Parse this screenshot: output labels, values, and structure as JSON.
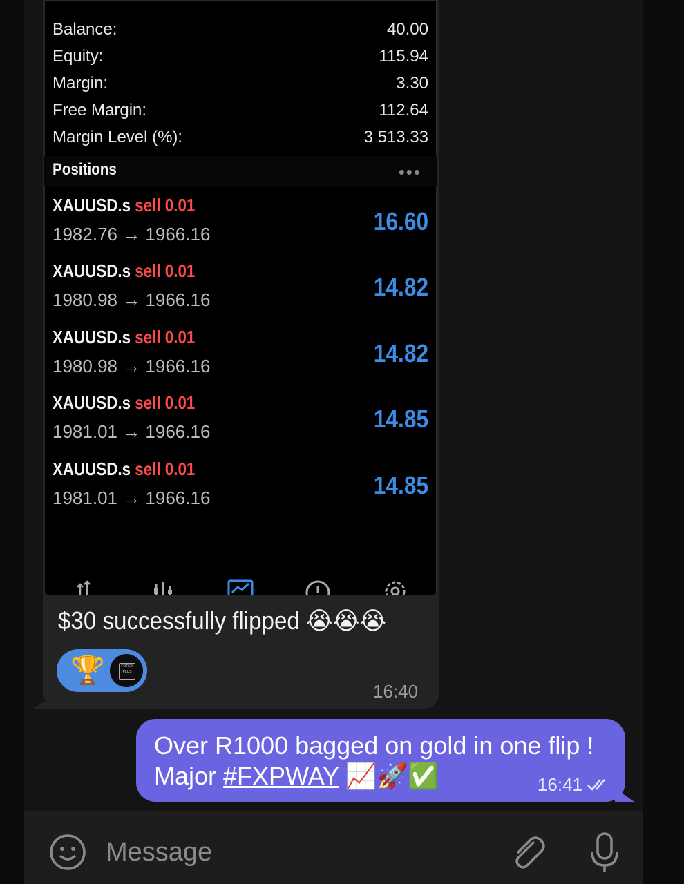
{
  "account": [
    {
      "label": "Balance:",
      "value": "40.00"
    },
    {
      "label": "Equity:",
      "value": "115.94"
    },
    {
      "label": "Margin:",
      "value": "3.30"
    },
    {
      "label": "Free Margin:",
      "value": "112.64"
    },
    {
      "label": "Margin Level (%):",
      "value": "3 513.33"
    }
  ],
  "positions_title": "Positions",
  "positions_more": "•••",
  "positions": [
    {
      "symbol": "XAUUSD.s",
      "side": "sell 0.01",
      "prices": "1982.76 → 1966.16",
      "profit": "16.60"
    },
    {
      "symbol": "XAUUSD.s",
      "side": "sell 0.01",
      "prices": "1980.98 → 1966.16",
      "profit": "14.82"
    },
    {
      "symbol": "XAUUSD.s",
      "side": "sell 0.01",
      "prices": "1980.98 → 1966.16",
      "profit": "14.82"
    },
    {
      "symbol": "XAUUSD.s",
      "side": "sell 0.01",
      "prices": "1981.01 → 1966.16",
      "profit": "14.85"
    },
    {
      "symbol": "XAUUSD.s",
      "side": "sell 0.01",
      "prices": "1981.01 → 1966.16",
      "profit": "14.85"
    }
  ],
  "incoming": {
    "caption": "$30 successfully flipped 😭😭😭",
    "reaction_emoji": "🏆",
    "avatar_text": "FOREX PLUS",
    "time": "16:40"
  },
  "outgoing": {
    "line1": "Over R1000 bagged on gold in one flip !",
    "line2_prefix": "Major ",
    "hashtag": "#FXPWAY",
    "line2_suffix": " 📈🚀✅",
    "time": "16:41"
  },
  "input": {
    "placeholder": "Message"
  },
  "colors": {
    "sell": "#ff4b4b",
    "profit": "#3b8de4",
    "outgoing_bubble": "#6b64e0",
    "reaction": "#4d8be0"
  },
  "icons": [
    "trade-icon",
    "chart-bars-icon",
    "chart-icon",
    "history-icon",
    "settings-icon",
    "emoji-icon",
    "paperclip-icon",
    "microphone-icon",
    "double-check-icon"
  ]
}
